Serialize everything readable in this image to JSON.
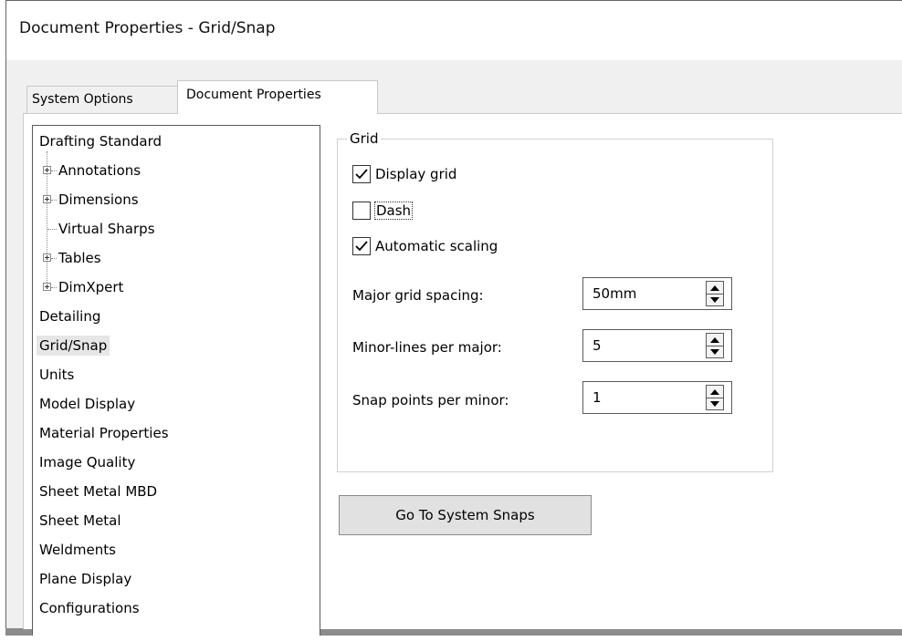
{
  "window": {
    "title": "Document Properties - Grid/Snap"
  },
  "tabs": [
    {
      "label": "System Options"
    },
    {
      "label": "Document Properties"
    }
  ],
  "tree": {
    "items": [
      {
        "label": "Drafting Standard",
        "level": 0
      },
      {
        "label": "Annotations",
        "level": 1,
        "expandable": true
      },
      {
        "label": "Dimensions",
        "level": 1,
        "expandable": true
      },
      {
        "label": "Virtual Sharps",
        "level": 1,
        "expandable": false
      },
      {
        "label": "Tables",
        "level": 1,
        "expandable": true
      },
      {
        "label": "DimXpert",
        "level": 1,
        "expandable": true
      },
      {
        "label": "Detailing",
        "level": 0
      },
      {
        "label": "Grid/Snap",
        "level": 0,
        "selected": true
      },
      {
        "label": "Units",
        "level": 0
      },
      {
        "label": "Model Display",
        "level": 0
      },
      {
        "label": "Material Properties",
        "level": 0
      },
      {
        "label": "Image Quality",
        "level": 0
      },
      {
        "label": "Sheet Metal MBD",
        "level": 0
      },
      {
        "label": "Sheet Metal",
        "level": 0
      },
      {
        "label": "Weldments",
        "level": 0
      },
      {
        "label": "Plane Display",
        "level": 0
      },
      {
        "label": "Configurations",
        "level": 0
      }
    ]
  },
  "grid": {
    "legend": "Grid",
    "display_grid": {
      "label": "Display grid",
      "checked": true
    },
    "dash": {
      "label": "Dash",
      "checked": false
    },
    "automatic_scaling": {
      "label": "Automatic scaling",
      "checked": true
    },
    "major_spacing": {
      "label": "Major grid spacing:",
      "value": "50mm"
    },
    "minor_lines": {
      "label": "Minor-lines per major:",
      "value": "5"
    },
    "snap_points": {
      "label": "Snap points per minor:",
      "value": "1"
    }
  },
  "buttons": {
    "go_to_system_snaps": "Go To System Snaps"
  },
  "icons": {
    "expand": "plus-box-icon",
    "check": "checkmark-icon",
    "spin_up": "triangle-up-icon",
    "spin_down": "triangle-down-icon"
  }
}
